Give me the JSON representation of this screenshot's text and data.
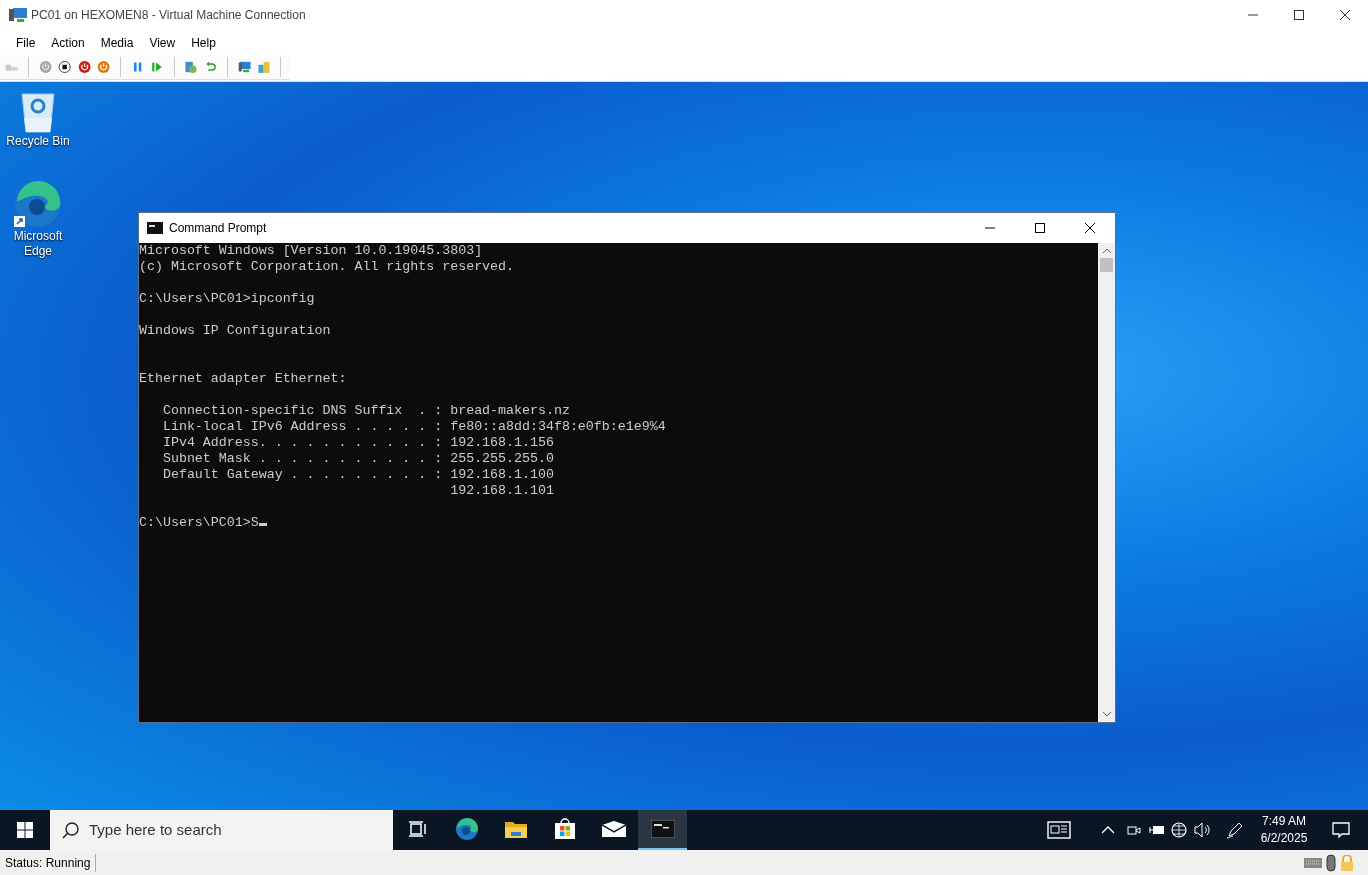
{
  "window": {
    "title": "PC01 on HEXOMEN8 - Virtual Machine Connection"
  },
  "menu": [
    "File",
    "Action",
    "Media",
    "View",
    "Help"
  ],
  "desktop_icons": [
    {
      "kind": "recycle",
      "label": "Recycle Bin"
    },
    {
      "kind": "edge",
      "label": "Microsoft Edge"
    }
  ],
  "console": {
    "title": "Command Prompt",
    "output": "Microsoft Windows [Version 10.0.19045.3803]\n(c) Microsoft Corporation. All rights reserved.\n\nC:\\Users\\PC01>ipconfig\n\nWindows IP Configuration\n\n\nEthernet adapter Ethernet:\n\n   Connection-specific DNS Suffix  . : bread-makers.nz\n   Link-local IPv6 Address . . . . . : fe80::a8dd:34f8:e0fb:e1e9%4\n   IPv4 Address. . . . . . . . . . . : 192.168.1.156\n   Subnet Mask . . . . . . . . . . . : 255.255.255.0\n   Default Gateway . . . . . . . . . : 192.168.1.100\n                                       192.168.1.101\n\nC:\\Users\\PC01>S",
    "cursor_visible": true
  },
  "taskbar": {
    "search_placeholder": "Type here to search",
    "apps": [
      {
        "kind": "task-view",
        "selected": false
      },
      {
        "kind": "edge",
        "selected": false
      },
      {
        "kind": "explorer",
        "selected": false
      },
      {
        "kind": "store",
        "selected": false
      },
      {
        "kind": "mail",
        "selected": false
      },
      {
        "kind": "console",
        "selected": true
      }
    ],
    "time": "7:49 AM",
    "date": "6/2/2025"
  },
  "status_bar": {
    "status": "Status: Running"
  }
}
